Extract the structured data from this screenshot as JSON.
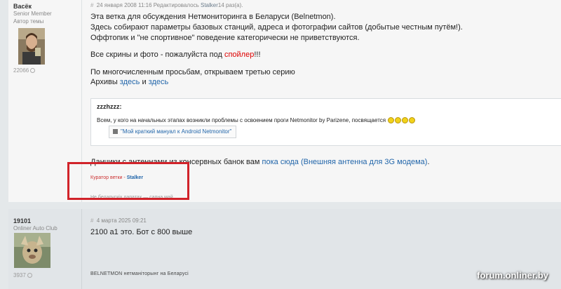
{
  "post1": {
    "author": {
      "name": "Васёк",
      "rank1": "Senior Member",
      "rank2": "Автор темы",
      "count": "22066"
    },
    "meta": {
      "date": "24 января 2008 11:16",
      "edited_prefix": "Редактировалось",
      "editor": "Stalker",
      "edit_count": "14 раз(а)."
    },
    "lines": {
      "l1": "Эта ветка для обсуждения Нетмониторинга в Беларуси (Belnetmon).",
      "l2": "Здесь собирают параметры базовых станций, адреса и фотографии сайтов (добытые честным путём!).",
      "l3": "Оффтопик и \"не спортивное\" поведение категорически не приветствуются.",
      "l4_pre": "Все скрины и фото - пожалуйста под",
      "l4_spoiler": "спойлер",
      "l4_post": "!!!",
      "l5": "По многочисленным просьбам, открываем третью серию",
      "l6_pre": "Архивы",
      "l6_link1": "здесь",
      "l6_mid": "и",
      "l6_link2": "здесь"
    },
    "quote": {
      "author": "zzzhzzz:",
      "text": "Всем, у кого на начальных этапах возникли проблемы с освоением проги Netmonitor by Parizene, посвящается",
      "button": "\"Мой краткий мануал к Android Netmonitor\""
    },
    "antenna": {
      "pre": "Данчики с антеннами из консервных банок вам",
      "link1": "пока сюда",
      "link2": "(Внешняя антенна для 3G модема)",
      "post": "."
    },
    "curator": {
      "label": "Куратор ветки -",
      "name": "Stalker"
    },
    "faded": "Не беларускіх лапатах — сапна май"
  },
  "post2": {
    "author": {
      "name": "19101",
      "rank": "Onliner Auto Club",
      "count": "3937"
    },
    "meta": {
      "date": "4 марта 2025 09:21"
    },
    "text": "2100 a1 это. Бот с 800 выше",
    "signature": "BELNETMON нетманіторынг на Беларусі"
  },
  "watermark": "forum.onliner.by",
  "colors": {
    "highlight_box": "#d1232a",
    "link": "#2266aa",
    "spoiler": "#dd0000"
  },
  "icons": {
    "meta_hash": "hash-icon",
    "button_icon": "book-icon",
    "count_dot": "reputation-icon"
  }
}
